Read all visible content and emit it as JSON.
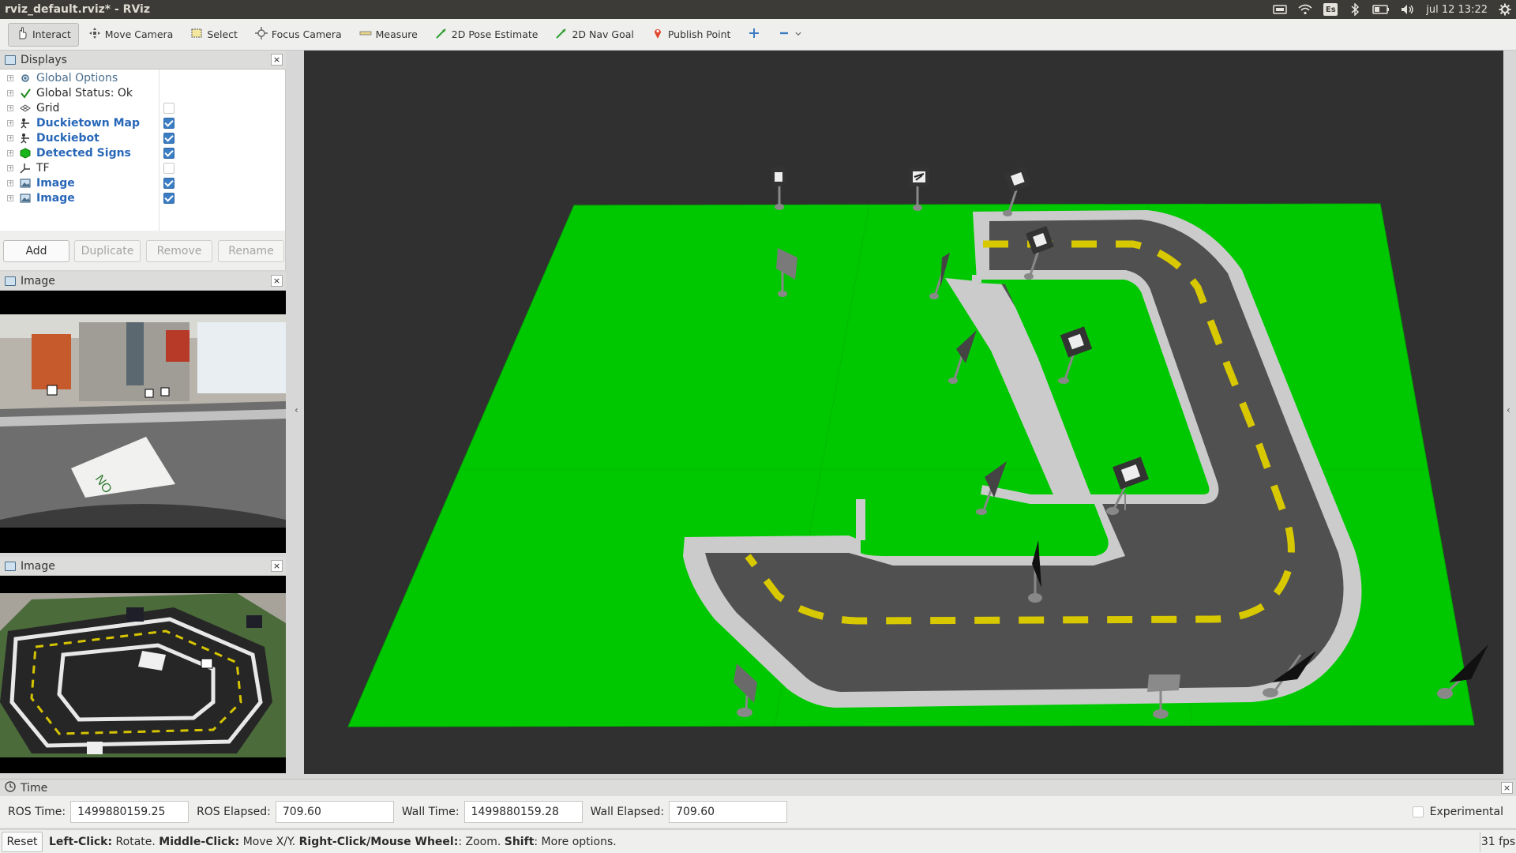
{
  "window": {
    "title": "rviz_default.rviz* - RViz"
  },
  "system_tray": {
    "keyboard_layout": "Es",
    "datetime": "jul 12 13:22"
  },
  "toolbar": {
    "tools": [
      {
        "label": "Interact",
        "icon": "hand-icon",
        "active": true
      },
      {
        "label": "Move Camera",
        "icon": "move-camera-icon"
      },
      {
        "label": "Select",
        "icon": "select-icon"
      },
      {
        "label": "Focus Camera",
        "icon": "focus-camera-icon"
      },
      {
        "label": "Measure",
        "icon": "measure-icon"
      },
      {
        "label": "2D Pose Estimate",
        "icon": "pose-estimate-icon"
      },
      {
        "label": "2D Nav Goal",
        "icon": "nav-goal-icon"
      },
      {
        "label": "Publish Point",
        "icon": "publish-point-icon"
      }
    ]
  },
  "displays": {
    "title": "Displays",
    "items": [
      {
        "label": "Global Options",
        "icon": "gear-icon",
        "style": "grey"
      },
      {
        "label": "Global Status: Ok",
        "icon": "check-icon",
        "style": "normal"
      },
      {
        "label": "Grid",
        "icon": "grid-icon",
        "style": "normal",
        "checked": false
      },
      {
        "label": "Duckietown Map",
        "icon": "robot-model-icon",
        "style": "blue",
        "checked": true
      },
      {
        "label": "Duckiebot",
        "icon": "robot-model-icon",
        "style": "blue",
        "checked": true
      },
      {
        "label": "Detected Signs",
        "icon": "marker-icon",
        "style": "blue",
        "checked": true
      },
      {
        "label": "TF",
        "icon": "tf-axes-icon",
        "style": "normal",
        "checked": false
      },
      {
        "label": "Image",
        "icon": "image-icon",
        "style": "blue",
        "checked": true
      },
      {
        "label": "Image",
        "icon": "image-icon",
        "style": "blue",
        "checked": true
      }
    ],
    "buttons": {
      "add": "Add",
      "duplicate": "Duplicate",
      "remove": "Remove",
      "rename": "Rename"
    }
  },
  "image_panels": [
    {
      "title": "Image"
    },
    {
      "title": "Image"
    }
  ],
  "time": {
    "title": "Time",
    "ros_time_label": "ROS Time:",
    "ros_time": "1499880159.25",
    "ros_elapsed_label": "ROS Elapsed:",
    "ros_elapsed": "709.60",
    "wall_time_label": "Wall Time:",
    "wall_time": "1499880159.28",
    "wall_elapsed_label": "Wall Elapsed:",
    "wall_elapsed": "709.60",
    "experimental_label": "Experimental"
  },
  "status": {
    "reset_label": "Reset",
    "help": {
      "left_click": "Left-Click:",
      "left_action": " Rotate. ",
      "middle_click": "Middle-Click:",
      "middle_action": " Move X/Y. ",
      "right_click": "Right-Click/Mouse Wheel:",
      "right_action": ": Zoom. ",
      "shift": "Shift",
      "shift_action": ": More options."
    },
    "fps": "31 fps"
  },
  "colors": {
    "ground": "#00c800",
    "road": "#505050",
    "road_edge": "#c8c8c8",
    "lane_marking": "#d8c800",
    "background": "#303030"
  }
}
